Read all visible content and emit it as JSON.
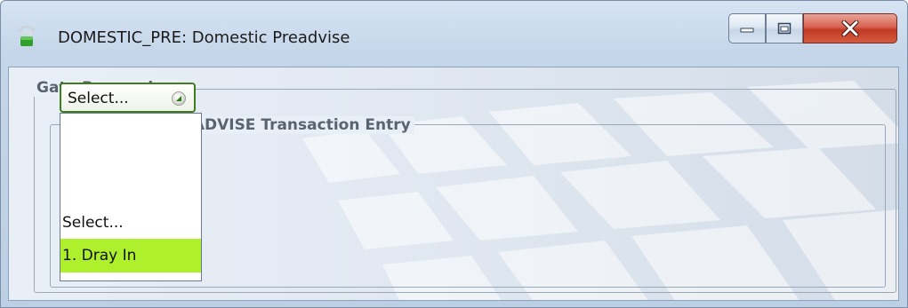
{
  "window": {
    "title": "DOMESTIC_PRE: Domestic Preadvise",
    "icon": "app-signal-icon",
    "caption_buttons": {
      "minimize": "minimize-icon",
      "maximize": "maximize-icon",
      "close": "close-icon"
    }
  },
  "gate_processing": {
    "legend": "Gate Processing",
    "transaction_entry": {
      "legend": "DOMESTIC PREADVISE Transaction Entry",
      "select": {
        "value": "Select...",
        "arrow_icon": "dropdown-arrow-icon"
      },
      "options": [
        {
          "label": "Select...",
          "selected": false
        },
        {
          "label": "1. Dray In",
          "selected": true
        }
      ]
    }
  },
  "colors": {
    "highlight": "#aef02b",
    "select_border": "#3f7d1f",
    "close_button": "#c23a24"
  }
}
